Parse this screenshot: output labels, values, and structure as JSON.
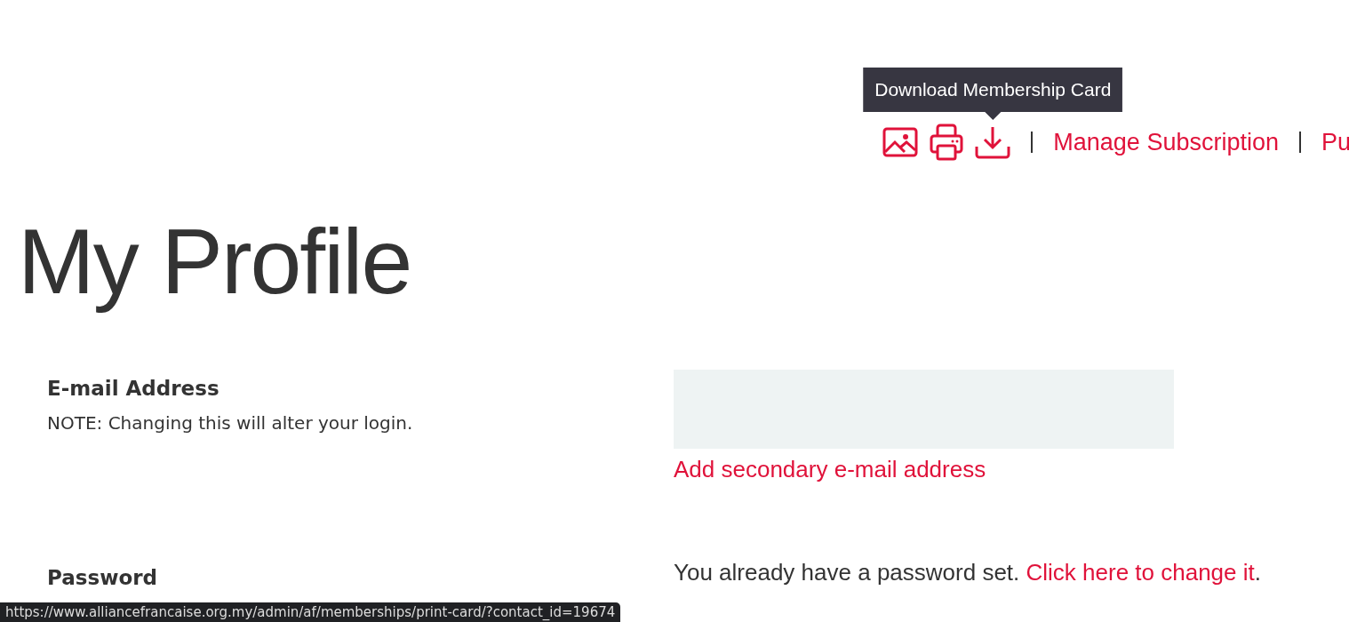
{
  "tooltip": {
    "text": "Download Membership Card"
  },
  "card_actions": [
    {
      "kind": "image"
    },
    {
      "kind": "print"
    },
    {
      "kind": "download"
    }
  ],
  "nav_links": [
    {
      "label": "Manage Subscription"
    },
    {
      "label": "Pu"
    }
  ],
  "page_title": "My Profile",
  "email": {
    "label": "E-mail Address",
    "note": "NOTE: Changing this will alter your login.",
    "add_link": "Add secondary e-mail address"
  },
  "password": {
    "label": "Password",
    "text": "You already have a password set.",
    "link": "Click here to change it",
    "trailing": "."
  },
  "status_bar": {
    "url": "https://www.alliancefrancaise.org.my/admin/af/memberships/print-card/?contact_id=19674"
  }
}
